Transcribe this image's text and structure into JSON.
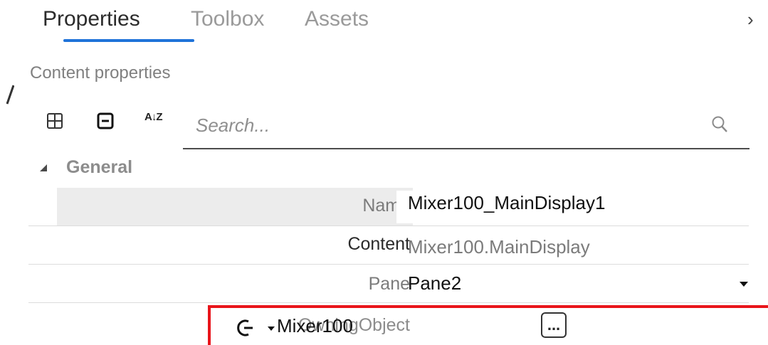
{
  "tabs": [
    {
      "label": "Properties",
      "active": true
    },
    {
      "label": "Toolbox",
      "active": false
    },
    {
      "label": "Assets",
      "active": false
    }
  ],
  "panel": {
    "collapse_glyph": "›",
    "section_title": "Content properties"
  },
  "toolbar": {
    "expand_all_icon": "expand-all-icon",
    "collapse_all_icon": "collapse-all-icon",
    "sort_icon": "sort-alphabetical-icon",
    "sort_glyph": "A↓Z",
    "search_placeholder": "Search...",
    "search_value": ""
  },
  "category": {
    "label": "General",
    "expanded": true
  },
  "properties": [
    {
      "label": "Name",
      "value": "Mixer100_MainDisplay1",
      "selected": true,
      "label_color": "#7b7b7b",
      "value_color": "#111111",
      "editable": true
    },
    {
      "label": "Content",
      "value": "Mixer100.MainDisplay",
      "selected": false,
      "label_color": "#2b2b2b",
      "value_color": "#7b7b7b",
      "editable": false
    },
    {
      "label": "Pane",
      "value": "Pane2",
      "selected": false,
      "label_color": "#7b7b7b",
      "value_color": "#111111",
      "editable": true,
      "has_dropdown": true
    },
    {
      "label": "OwningObject",
      "value": "Mixer100",
      "selected": false,
      "label_color": "#8c8c8c",
      "value_color": "#111111",
      "editable": true,
      "highlighted": true,
      "link_icon": "link-refresh-icon",
      "button_label": "..."
    }
  ],
  "colors": {
    "accent": "#1f73d9",
    "highlight_border": "#e8141a"
  }
}
